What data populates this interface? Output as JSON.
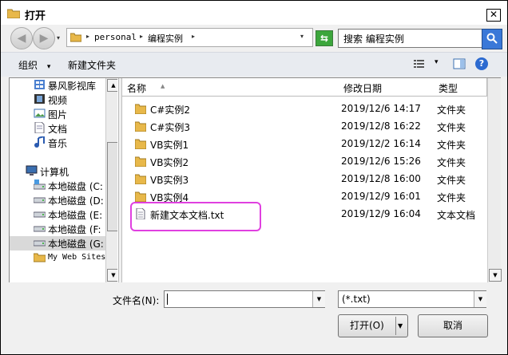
{
  "window": {
    "title": "打开",
    "close_glyph": "✕"
  },
  "nav": {
    "back_glyph": "◀",
    "forward_glyph": "▶",
    "history_glyph": "▾",
    "path": [
      "personal",
      "编程实例"
    ],
    "sep_glyph": "▸",
    "dropdown_glyph": "▾",
    "refresh_glyph": "⇆"
  },
  "search": {
    "placeholder": "搜索 编程实例",
    "icon": "search-icon"
  },
  "toolbar": {
    "organize_label": "组织",
    "organize_arrow": "▾",
    "new_folder_label": "新建文件夹",
    "view_arrow": "▾",
    "help_glyph": "?"
  },
  "sidebar": {
    "items": [
      {
        "label": "暴风影视库",
        "icon": "library-icon"
      },
      {
        "label": "视频",
        "icon": "video-icon"
      },
      {
        "label": "图片",
        "icon": "picture-icon"
      },
      {
        "label": "文档",
        "icon": "document-icon"
      },
      {
        "label": "音乐",
        "icon": "music-icon"
      },
      {
        "label": "计算机",
        "icon": "computer-icon"
      },
      {
        "label": "本地磁盘 (C:",
        "icon": "drive-icon"
      },
      {
        "label": "本地磁盘 (D:",
        "icon": "drive-icon"
      },
      {
        "label": "本地磁盘 (E:",
        "icon": "drive-icon"
      },
      {
        "label": "本地磁盘 (F:",
        "icon": "drive-icon"
      },
      {
        "label": "本地磁盘 (G:",
        "icon": "drive-icon"
      },
      {
        "label": "My Web Sites",
        "icon": "folder-icon"
      }
    ],
    "selected_index": 10
  },
  "columns": {
    "name": "名称",
    "date": "修改日期",
    "type": "类型",
    "sort_glyph": "▲"
  },
  "files": [
    {
      "name": "C#实例2",
      "date": "2019/12/6 14:17",
      "type": "文件夹",
      "kind": "folder"
    },
    {
      "name": "C#实例3",
      "date": "2019/12/8 16:22",
      "type": "文件夹",
      "kind": "folder"
    },
    {
      "name": "VB实例1",
      "date": "2019/12/2 16:14",
      "type": "文件夹",
      "kind": "folder"
    },
    {
      "name": "VB实例2",
      "date": "2019/12/6 15:26",
      "type": "文件夹",
      "kind": "folder"
    },
    {
      "name": "VB实例3",
      "date": "2019/12/8 16:00",
      "type": "文件夹",
      "kind": "folder"
    },
    {
      "name": "VB实例4",
      "date": "2019/12/9 16:01",
      "type": "文件夹",
      "kind": "folder"
    },
    {
      "name": "新建文本文档.txt",
      "date": "2019/12/9 16:04",
      "type": "文本文档",
      "kind": "text"
    }
  ],
  "scroll": {
    "up_glyph": "▲",
    "down_glyph": "▼"
  },
  "bottom": {
    "filename_label": "文件名(N):",
    "filename_value": "",
    "filter_value": "(*.txt)",
    "dd_glyph": "▼",
    "open_label": "打开(O)",
    "open_arrow": "▼",
    "cancel_label": "取消"
  },
  "colors": {
    "highlight": "#e040e0",
    "folder": "#e8b84a"
  }
}
